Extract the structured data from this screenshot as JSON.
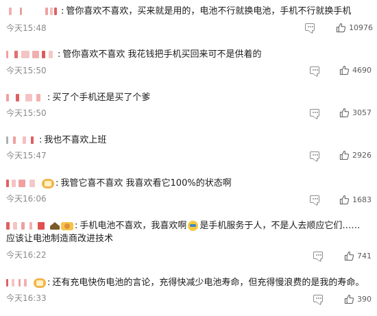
{
  "comments": [
    {
      "text": "管你喜欢不喜欢，买来就是用的，电池不行就换电池，手机不行就换手机",
      "time": "今天15:48",
      "likes": "10976"
    },
    {
      "text": "管你喜欢不喜欢 我花钱把手机买回来可不是供着的",
      "time": "今天15:50",
      "likes": "4690"
    },
    {
      "text": "买了个手机还是买了个爹",
      "time": "今天15:50",
      "likes": "3057"
    },
    {
      "text": "我也不喜欢上班",
      "time": "今天15:47",
      "likes": "2926"
    },
    {
      "text": "我管它喜不喜欢 我喜欢看它100%的状态啊",
      "time": "今天16:06",
      "likes": "1683"
    },
    {
      "text_a": "手机电池不喜欢，我喜欢啊",
      "text_b": "是手机服务于人，不是人去顺应它们……应该让电池制造商改进技术",
      "time": "今天16:22",
      "likes": "741"
    },
    {
      "text": "还有充电快伤电池的言论，充得快减少电池寿命，但充得慢浪费的是我的寿命。",
      "time": "今天16:33",
      "likes": "390"
    }
  ],
  "colors": {
    "text": "#1a1a1a",
    "meta": "#8a8a8a",
    "blur_pink": "#f0a0a0",
    "blur_red": "#e05050"
  },
  "icons": {
    "reply": "comment-bubble-icon",
    "like": "thumbs-up-icon"
  }
}
